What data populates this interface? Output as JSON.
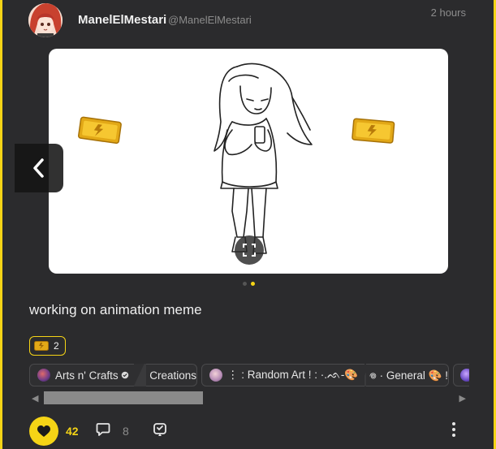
{
  "post": {
    "username": "ManelElMestari",
    "handle": "@ManelElMestari",
    "time": "2 hours",
    "caption": "working on animation meme"
  },
  "carousel": {
    "slide_count": 2,
    "active_slide": 2
  },
  "awards": {
    "count": "2"
  },
  "communities": [
    {
      "label": "Arts n' Crafts",
      "suffix": "Creations",
      "icon": "art-palette-avatar"
    },
    {
      "label": "⋮ : Random Art ! : ·.ᨒ-🎨",
      "suffix": "𖦹 · General 🎨 !",
      "icon": "random-art-avatar"
    }
  ],
  "actions": {
    "likes": "42",
    "comments": "8"
  },
  "colors": {
    "accent": "#f5d416",
    "background": "#2b2b2d"
  }
}
